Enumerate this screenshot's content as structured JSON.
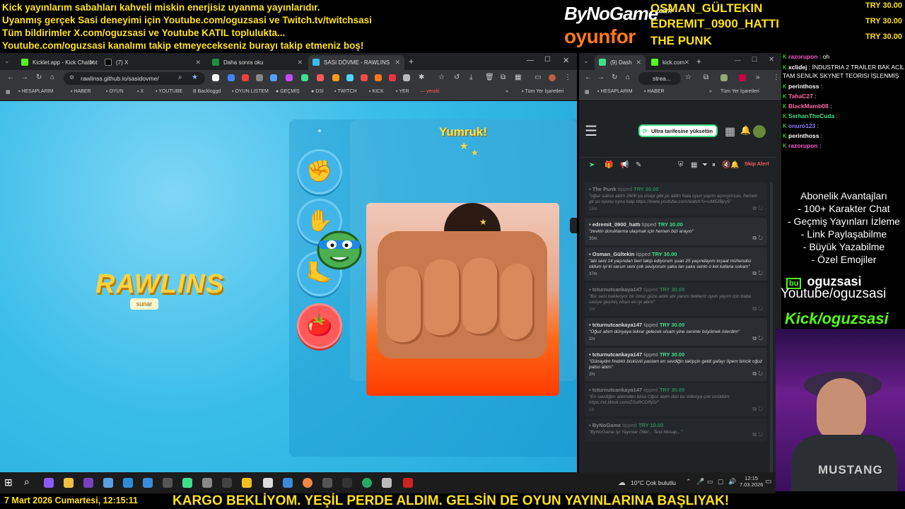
{
  "ticker": [
    "Kick yayınlarım sabahları kahveli miskin enerjisiz uyanma yayınlarıdır.",
    "Uyanmış gerçek Sasi deneyimi için Youtube.com/oguzsasi ve Twitch.tv/twitchsasi",
    "Tüm bildirimler X.com/oguzsasi ve Youtube KATIL toplulukta...",
    "Youtube.com/oguzsasi kanalımı takip etmeyecekseniz burayı takip etmeniz boş!"
  ],
  "sponsors": {
    "logo1": "ByNoGame",
    "logo1_sup": ".com",
    "logo2": "oyunfor"
  },
  "top_donors": [
    {
      "name": "OSMAN_GÜLTEKIN",
      "amount": "TRY 30.00"
    },
    {
      "name": "EDREMIT_0900_HATTI",
      "amount": "TRY 30.00"
    },
    {
      "name": "THE PUNK",
      "amount": "TRY 30.00"
    }
  ],
  "browser_left": {
    "tabs": [
      "Kicklet.app - Kick Chatbot and",
      "(7) X",
      "Daha sonra oku",
      "SASI DÖVME - RAWLINS"
    ],
    "url": "rawlinss.github.io/sasidovme/",
    "bookmarks": [
      "HESAPLARIM",
      "HABER",
      "OYUN",
      "X",
      "YOUTUBE",
      "Backloggd",
      "OYUN LISTEM",
      "GEÇMİŞ",
      "DSİ",
      "TWITCH",
      "KICK",
      "YER",
      "yeralti",
      "Tüm Yer İşaretleri"
    ]
  },
  "game": {
    "title": "RAWLINS",
    "subtitle": "sunar",
    "action": "Yumruk!",
    "tools": [
      "fist-tool",
      "hand-tool",
      "foot-tool",
      "tomato-tool"
    ]
  },
  "browser_right": {
    "tabs": [
      "(9) Dash",
      "kick.com"
    ],
    "url": "strea...",
    "bookmarks": [
      "HESAPLARIM",
      "HABER",
      "Tüm Yer İşaretleri"
    ],
    "upgrade_label": "Ultra tarifesine yükseltin",
    "skip_label": "Skip Alert",
    "events": [
      {
        "user": "The Punk",
        "verb": "tipped",
        "amount": "TRY 30.00",
        "msg": "\"oğuz sakso abim 260K'ya enayi gibi pc aldın hala oyun yayını açmıyorsun, hemen git şu oyunu oyna kalp https://www.youtube.com/watch?v=uM52Bjry5\"",
        "time": "18m",
        "dim": true
      },
      {
        "user": "edremit_0900_hattı",
        "verb": "tipped",
        "amount": "TRY 30.00",
        "msg": "\"zevkin doruklarına ulaşmak için hemen bizi arayın\"",
        "time": "35m",
        "dim": false
      },
      {
        "user": "Osman_Gültekin",
        "verb": "tipped",
        "amount": "TRY 30.00",
        "msg": "\"abi seni 14 yaşından beri takip ediyorum şuan 25 yaşındayım inşaat mühendisi oldum iyi ki varsın seni çok seviyorum şaka lan şaka senin o kel kafana sokam\"",
        "time": "37m",
        "dim": false
      },
      {
        "user": "tcturnutcankaya147",
        "verb": "tipped",
        "amount": "TRY 30.00",
        "msg": "\"Biz seni bekleriyor bir ömür güze aldık abi yanını bekleriz oyun yayını için baba sasiye geçmiş olsun en iyi abim\"",
        "time": "1hr",
        "dim": true
      },
      {
        "user": "tcturnutcankaya147",
        "verb": "tipped",
        "amount": "TRY 30.00",
        "msg": "\"Oğuz abim dünyaya tekrar gelecek olsam yine seninle büyümek isterdim\"",
        "time": "1hr",
        "dim": false
      },
      {
        "user": "tcturnutcankaya147",
        "verb": "tipped",
        "amount": "TRY 30.00",
        "msg": "\"Günaydın fındıklı bisküvili pastam en sevdiğin takipçin geldi gafayı öpem biricik oğuz patso abim\"",
        "time": "2hr",
        "dim": false
      },
      {
        "user": "tcturnutcankaya147",
        "verb": "tipped",
        "amount": "TRY 30.00",
        "msg": "\"En sevdiğim ailemden birisi Oğuz abim dün bu videoya çok üzüldüm https://vt.tiktok.com/ZSuRCDRjG/\"",
        "time": "1d",
        "dim": true
      },
      {
        "user": "ByNoGame",
        "verb": "tipped",
        "amount": "TRY 10.00",
        "msg": "\"ByNoGame İyi Yayınlar Diler... Test Mesajı...\"",
        "time": "",
        "dim": true
      }
    ]
  },
  "chat": [
    {
      "user": "razorupon",
      "msg": "oh",
      "color": "#ff5ad2"
    },
    {
      "user": "xclidej",
      "msg": "İNDUSTRIA 2 TRAİLER BAK ACİL TAM SENLİK SKYNET TEORISI İŞLENMİŞ",
      "color": "#fff"
    },
    {
      "user": "perinthoss",
      "msg": "",
      "color": "#fff"
    },
    {
      "user": "TahaC27",
      "msg": "",
      "color": "#ff6aa8"
    },
    {
      "user": "BlackMamb08",
      "msg": "",
      "color": "#ff6aa8"
    },
    {
      "user": "SerhanTheCuda",
      "msg": "",
      "color": "#3ee08a"
    },
    {
      "user": "onuro123",
      "msg": "",
      "color": "#8a7bff"
    },
    {
      "user": "perinthoss",
      "msg": "",
      "color": "#fff"
    },
    {
      "user": "razorupon",
      "msg": "",
      "color": "#ff5ad2"
    }
  ],
  "perks": {
    "title": "Abonelik Avantajları",
    "items": [
      "- 100+ Karakter Chat",
      "- Geçmiş Yayınları İzleme",
      "- Link Paylaşabilme",
      "- Büyük Yazabilme",
      "- Özel Emojiler"
    ]
  },
  "socials": {
    "brand": "oguzsasi",
    "youtube": "Youtube/oguzsasi",
    "kick": "Kick/oguzsasi"
  },
  "webcam": {
    "shirt_text": "MUSTANG"
  },
  "taskbar": {
    "weather": "10°C Çok bulutlu",
    "time": "12:15",
    "date": "7.03.2026"
  },
  "footer": {
    "date": "7 Mart 2026 Cumartesi, 12:15:11",
    "banner": "KARGO BEKLİYOM. YEŞİL PERDE ALDIM. GELSİN DE OYUN YAYINLARINA BAŞLIYAK!"
  },
  "colors": {
    "ticker": "#ffe11a",
    "kick_green": "#53fc18",
    "page_blue": "#2aaee0",
    "brand_orange": "#ff7a1a"
  }
}
